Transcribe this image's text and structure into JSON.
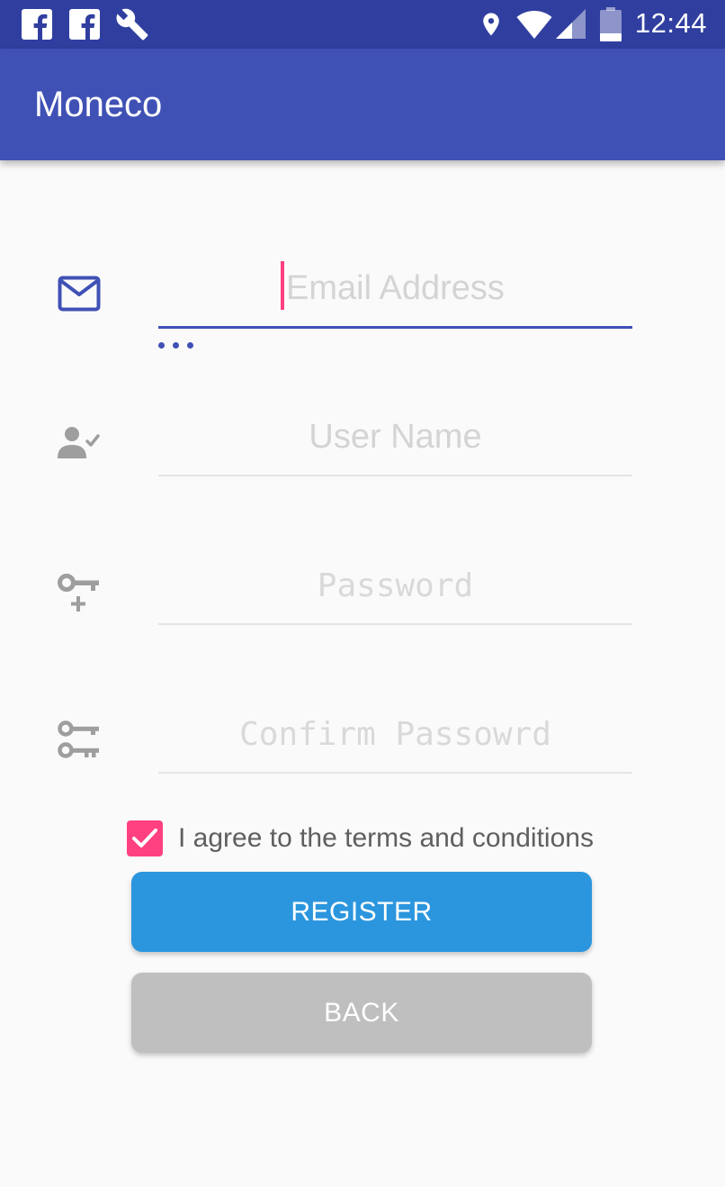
{
  "status_bar": {
    "time": "12:44",
    "left_icons": [
      "facebook-icon",
      "facebook-icon",
      "wrench-icon"
    ],
    "right_icons": [
      "location-icon",
      "wifi-icon",
      "signal-icon",
      "battery-icon"
    ]
  },
  "app_bar": {
    "title": "Moneco"
  },
  "form": {
    "email": {
      "placeholder": "Email Address",
      "value": "",
      "icon": "email-icon"
    },
    "username": {
      "placeholder": "User Name",
      "value": "",
      "icon": "user-check-icon"
    },
    "password": {
      "placeholder": "Password",
      "value": "",
      "icon": "key-plus-icon"
    },
    "confirm_password": {
      "placeholder": "Confirm Passowrd",
      "value": "",
      "icon": "keys-icon"
    }
  },
  "terms": {
    "label": "I agree to the terms and conditions",
    "checked": true
  },
  "buttons": {
    "register": "REGISTER",
    "back": "BACK"
  },
  "colors": {
    "status_bar": "#303f9f",
    "primary": "#3f51b5",
    "accent": "#ff4081",
    "register_button": "#2b96de",
    "back_button": "#bfbfbf"
  }
}
